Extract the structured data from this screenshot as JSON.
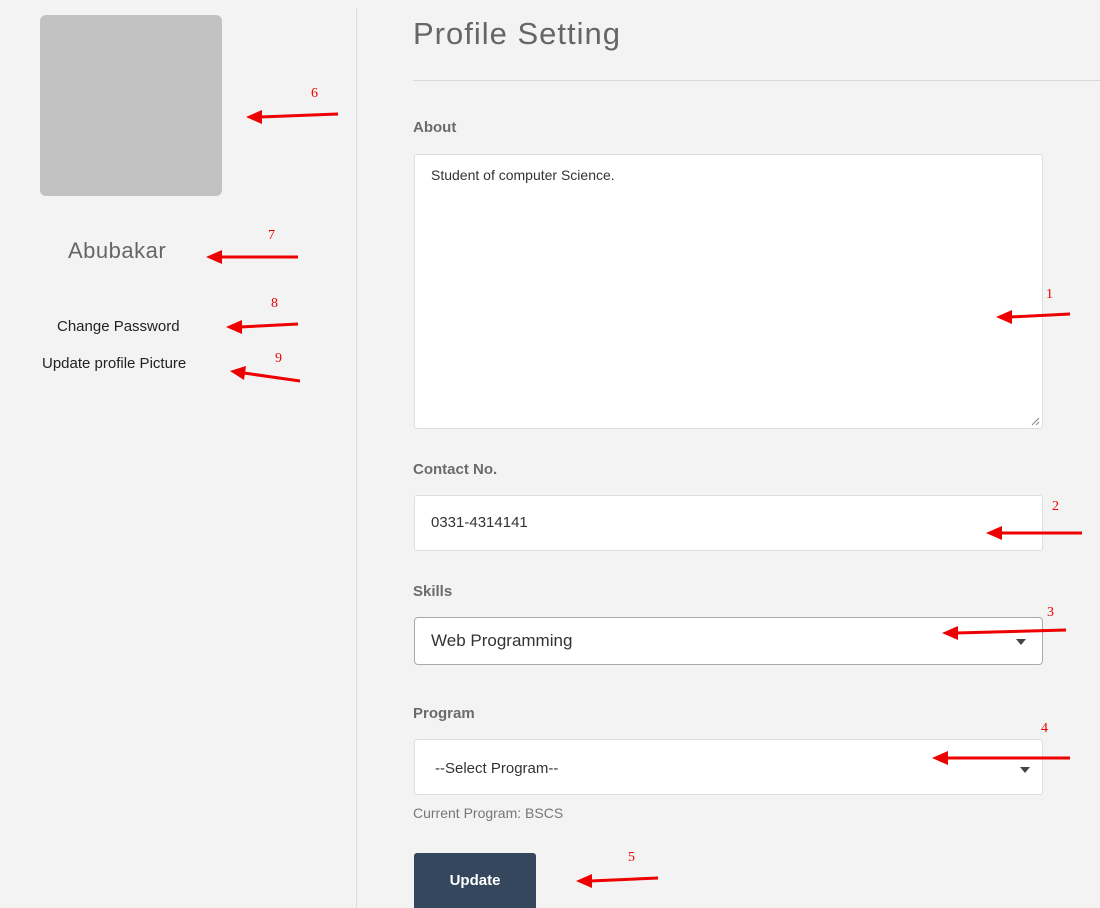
{
  "sidebar": {
    "user_name": "Abubakar",
    "links": {
      "change_password": "Change Password",
      "update_picture": "Update profile Picture"
    }
  },
  "main": {
    "title": "Profile Setting",
    "about": {
      "label": "About",
      "value": "Student of computer Science."
    },
    "contact": {
      "label": "Contact No.",
      "value": "0331-4314141"
    },
    "skills": {
      "label": "Skills",
      "selected": "Web Programming"
    },
    "program": {
      "label": "Program",
      "selected": "--Select Program--",
      "current": "Current Program: BSCS"
    },
    "update_label": "Update"
  },
  "annotations": [
    "1",
    "2",
    "3",
    "4",
    "5",
    "6",
    "7",
    "8",
    "9"
  ],
  "colors": {
    "annotation": "#ee0000",
    "button": "#34475d",
    "avatar": "#c2c2c2",
    "background": "#f3f3f3"
  }
}
